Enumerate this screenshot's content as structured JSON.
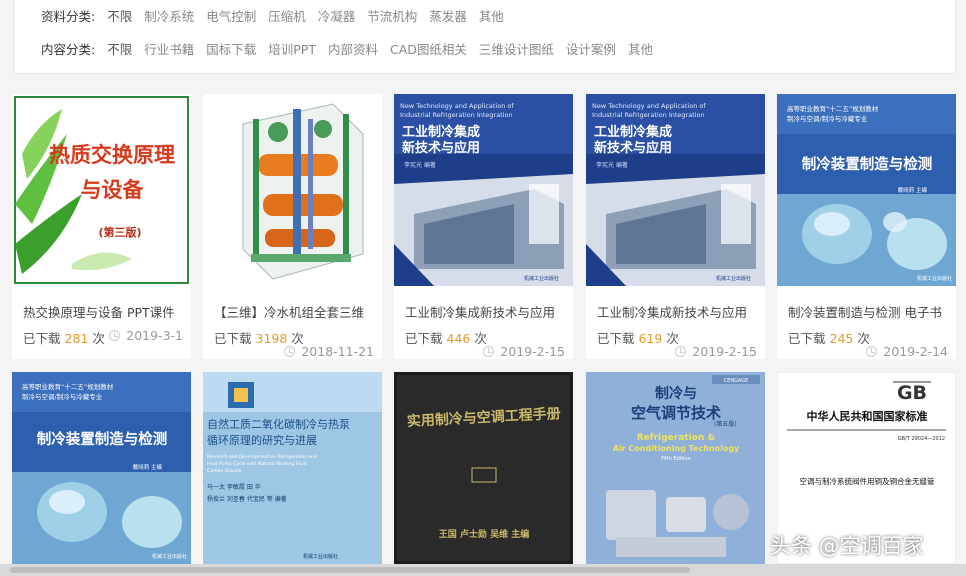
{
  "filters": {
    "row1": {
      "label": "资料分类:",
      "options": [
        "不限",
        "制冷系统",
        "电气控制",
        "压缩机",
        "冷凝器",
        "节流机构",
        "蒸发器",
        "其他"
      ]
    },
    "row2": {
      "label": "内容分类:",
      "options": [
        "不限",
        "行业书籍",
        "国标下载",
        "培训PPT",
        "内部资料",
        "CAD图纸相关",
        "三维设计图纸",
        "设计案例",
        "其他"
      ]
    }
  },
  "cards": [
    {
      "title": "热交换原理与设备 PPT课件",
      "downloads_prefix": "已下载",
      "downloads": "281",
      "downloads_suffix": "次",
      "date": "2019-3-1",
      "cover_title_1": "热质交换原理",
      "cover_title_2": "与设备",
      "cover_edition": "(第三版)"
    },
    {
      "title": "【三维】冷水机组全套三维",
      "downloads_prefix": "已下载",
      "downloads": "3198",
      "downloads_suffix": "次",
      "date": "2018-11-21"
    },
    {
      "title": "工业制冷集成新技术与应用",
      "downloads_prefix": "已下载",
      "downloads": "446",
      "downloads_suffix": "次",
      "date": "2019-2-15",
      "cover_en_1": "New Technology and Application of",
      "cover_en_2": "Industrial Refrigeration Integration",
      "cover_title_1": "工业制冷集成",
      "cover_title_2": "新技术与应用",
      "cover_author": "李宪光 编著",
      "cover_publisher": "机械工业出版社"
    },
    {
      "title": "工业制冷集成新技术与应用",
      "downloads_prefix": "已下载",
      "downloads": "619",
      "downloads_suffix": "次",
      "date": "2019-2-15",
      "cover_en_1": "New Technology and Application of",
      "cover_en_2": "Industrial Refrigeration Integration",
      "cover_title_1": "工业制冷集成",
      "cover_title_2": "新技术与应用",
      "cover_author": "李宪光 编著",
      "cover_publisher": "机械工业出版社"
    },
    {
      "title": "制冷装置制造与检测 电子书",
      "downloads_prefix": "已下载",
      "downloads": "245",
      "downloads_suffix": "次",
      "date": "2019-2-14",
      "cover_series_1": "高等职业教育“十二五”规划教材",
      "cover_series_2": "制冷与空调/制冷与冷藏专业",
      "cover_title": "制冷装置制造与检测",
      "cover_author": "戴晓莉 主编",
      "cover_publisher": "机械工业出版社"
    }
  ],
  "row2_covers": [
    {
      "series_1": "高等职业教育“十二五”规划教材",
      "series_2": "制冷与空调/制冷与冷藏专业",
      "title": "制冷装置制造与检测",
      "author": "戴晓莉 主编",
      "publisher": "机械工业出版社"
    },
    {
      "title_1": "自然工质二氧化碳制冷与热泵",
      "title_2": "循环原理的研究与进展",
      "en_1": "Research and Development on Refrigeration and",
      "en_2": "Heat Pump Cycle with Natural Working Fluid",
      "en_3": "Carbon Dioxide",
      "authors_1": "马一太  李敏霞  田  华",
      "authors_2": "杨俊兰  刘圣春  代宝民   等  编著",
      "publisher": "机械工业出版社"
    },
    {
      "title": "实用制冷与空调工程手册",
      "authors": "王国 卢士勋 吴维 主编"
    },
    {
      "title_1": "制冷与",
      "title_2": "空气调节技术",
      "edition": "(第五版)",
      "en_1": "Refrigeration &",
      "en_2": "Air Conditioning Technology",
      "en_3": "Fifth Edition",
      "logo": "CENGAGE"
    },
    {
      "logo": "GB",
      "title": "中华人民共和国国家标准",
      "code": "GB/T 29024—2012",
      "subtitle": "空调与制冷系统阀件用铜及铜合金无缝管"
    }
  ],
  "watermark": "头条 @空调百家"
}
